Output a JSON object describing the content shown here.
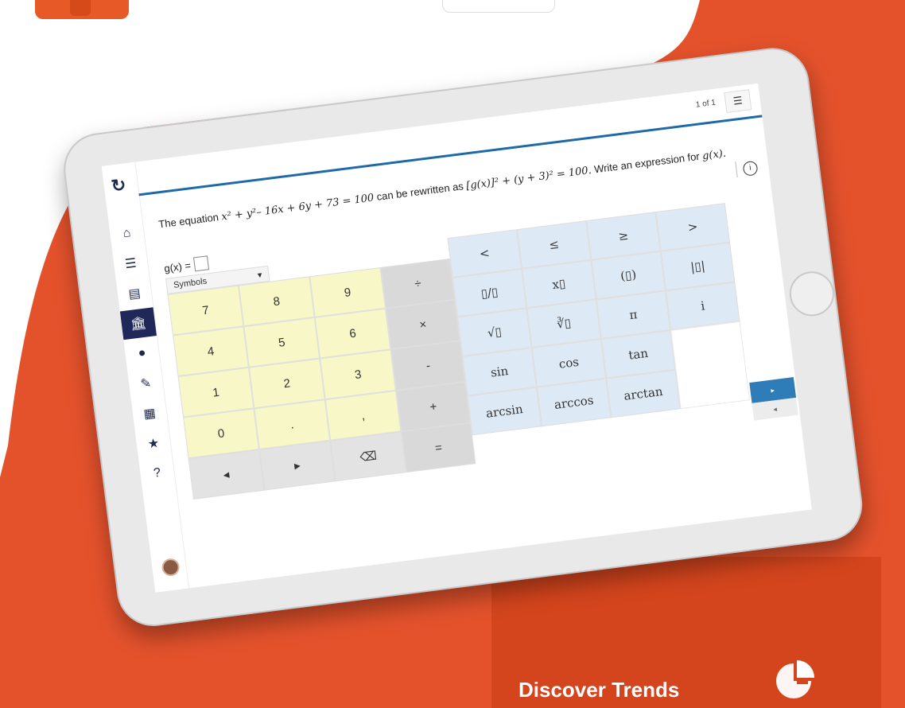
{
  "colors": {
    "background": "#e4522c",
    "brand_blue": "#1f6aa6",
    "sidebar_active": "#20285a",
    "number_keys": "#f7f7c8",
    "operator_keys": "#d9d9d9",
    "function_keys": "#dde9f5",
    "next_button": "#2e7cb8"
  },
  "header": {
    "page_counter": "1 of 1",
    "list_icon": "list-icon"
  },
  "sidebar": {
    "logo_icon": "logo-icon",
    "items": [
      {
        "icon": "home-icon",
        "glyph": "⌂"
      },
      {
        "icon": "list-icon",
        "glyph": "☰"
      },
      {
        "icon": "book-icon",
        "glyph": "▤"
      },
      {
        "icon": "bank-icon",
        "glyph": "🏛"
      },
      {
        "icon": "record-icon",
        "glyph": "●"
      },
      {
        "icon": "pencil-icon",
        "glyph": "✎"
      },
      {
        "icon": "calendar-icon",
        "glyph": "▦"
      },
      {
        "icon": "star-icon",
        "glyph": "★"
      },
      {
        "icon": "help-icon",
        "glyph": "?"
      }
    ]
  },
  "question": {
    "prefix": "The equation",
    "equation1": "x² + y²– 16x + 6y + 73 = 100",
    "middle": "can be rewritten as",
    "equation2": "[g(x)]² + (y + 3)² = 100.",
    "suffix": "Write an expression for",
    "target": "g(x)."
  },
  "answer": {
    "label": "g(x) ="
  },
  "symbols_dropdown": {
    "selected": "Symbols",
    "caret": "▾"
  },
  "keypad": {
    "numbers": [
      "7",
      "8",
      "9",
      "4",
      "5",
      "6",
      "1",
      "2",
      "3",
      "0",
      ".",
      ","
    ],
    "operators": [
      "÷",
      "×",
      "-",
      "+",
      "="
    ],
    "nav": [
      "◂",
      "▸",
      "⌫"
    ],
    "functions": [
      "<",
      "≤",
      "≥",
      ">",
      "▯/▯",
      "x▯",
      "(▯)",
      "|▯|",
      "√▯",
      "∛▯",
      "π",
      "i",
      "sin",
      "cos",
      "tan",
      "arcsin",
      "arccos",
      "arctan"
    ]
  },
  "navigation": {
    "next": "▸",
    "prev": "◂"
  },
  "footer": {
    "title": "Discover Trends"
  }
}
